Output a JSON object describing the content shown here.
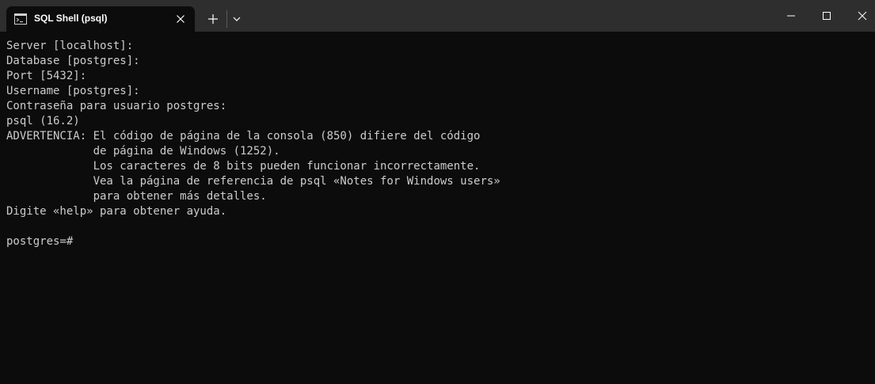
{
  "window": {
    "tab_title": "SQL Shell (psql)",
    "icons": {
      "tab": "terminal-icon",
      "close_tab": "close-icon",
      "new_tab": "plus-icon",
      "dropdown": "chevron-down-icon",
      "minimize": "minimize-icon",
      "maximize": "maximize-icon",
      "close": "close-icon"
    },
    "colors": {
      "titlebar": "#2e2e2e",
      "background": "#0c0c0c",
      "text": "#cccccc"
    }
  },
  "terminal": {
    "lines": [
      "Server [localhost]:",
      "Database [postgres]:",
      "Port [5432]:",
      "Username [postgres]:",
      "Contraseña para usuario postgres:",
      "psql (16.2)",
      "ADVERTENCIA: El código de página de la consola (850) difiere del código",
      "             de página de Windows (1252).",
      "             Los caracteres de 8 bits pueden funcionar incorrectamente.",
      "             Vea la página de referencia de psql «Notes for Windows users»",
      "             para obtener más detalles.",
      "Digite «help» para obtener ayuda.",
      "",
      "postgres=#"
    ]
  }
}
